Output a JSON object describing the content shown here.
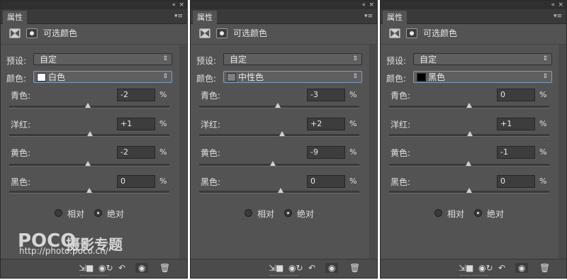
{
  "panels": [
    {
      "tab": "属性",
      "title": "可选颜色",
      "preset_label": "预设:",
      "preset_value": "自定",
      "color_label": "颜色:",
      "color_value": "白色",
      "swatch": "#ffffff",
      "sliders": [
        {
          "label": "青色:",
          "value": "-2",
          "unit": "%"
        },
        {
          "label": "洋红:",
          "value": "+1",
          "unit": "%"
        },
        {
          "label": "黄色:",
          "value": "-2",
          "unit": "%"
        },
        {
          "label": "黑色:",
          "value": "0",
          "unit": "%"
        }
      ],
      "relative": "相对",
      "absolute": "绝对"
    },
    {
      "tab": "属性",
      "title": "可选颜色",
      "preset_label": "预设:",
      "preset_value": "自定",
      "color_label": "颜色:",
      "color_value": "中性色",
      "swatch": "#808080",
      "sliders": [
        {
          "label": "青色:",
          "value": "-3",
          "unit": "%"
        },
        {
          "label": "洋红:",
          "value": "+2",
          "unit": "%"
        },
        {
          "label": "黄色:",
          "value": "-9",
          "unit": "%"
        },
        {
          "label": "黑色:",
          "value": "0",
          "unit": "%"
        }
      ],
      "relative": "相对",
      "absolute": "绝对"
    },
    {
      "tab": "属性",
      "title": "可选颜色",
      "preset_label": "预设:",
      "preset_value": "自定",
      "color_label": "颜色:",
      "color_value": "黑色",
      "swatch": "#000000",
      "sliders": [
        {
          "label": "青色:",
          "value": "0",
          "unit": "%"
        },
        {
          "label": "洋红:",
          "value": "+1",
          "unit": "%"
        },
        {
          "label": "黄色:",
          "value": "-1",
          "unit": "%"
        },
        {
          "label": "黑色:",
          "value": "0",
          "unit": "%"
        }
      ],
      "relative": "相对",
      "absolute": "绝对"
    }
  ],
  "icons": {
    "collapse": "«",
    "close": "×",
    "menu": "▾≡",
    "select_arrow": "⇕",
    "bottom": [
      "clip-to-layer-icon",
      "view-previous-state-icon",
      "reset-icon",
      "visibility-eye-icon",
      "delete-trash-icon"
    ]
  },
  "watermark": {
    "logo": "POCO",
    "name": "摄影专题",
    "url": "http://photo.poco.cn/"
  }
}
